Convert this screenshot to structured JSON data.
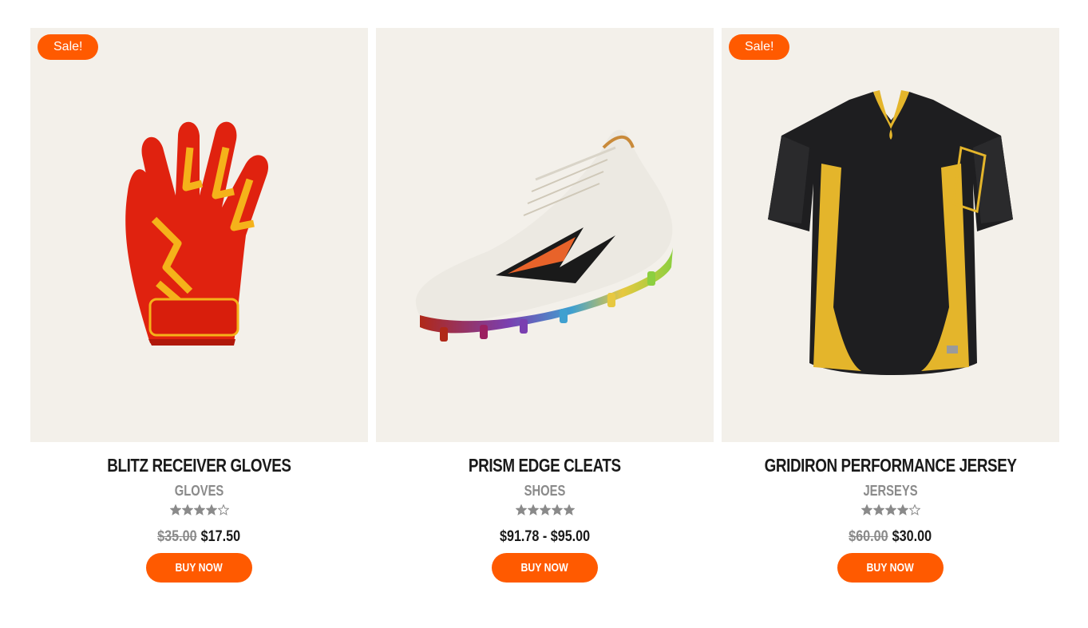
{
  "products": [
    {
      "sale_badge": "Sale!",
      "title": "Blitz Receiver Gloves",
      "category": "Gloves",
      "rating": 4,
      "price_old": "$35.00",
      "price_new": "$17.50",
      "button": "Buy Now"
    },
    {
      "sale_badge": "",
      "title": "Prism Edge Cleats",
      "category": "Shoes",
      "rating": 5,
      "price_range": "$91.78 - $95.00",
      "button": "Buy Now"
    },
    {
      "sale_badge": "Sale!",
      "title": "Gridiron Performance Jersey",
      "category": "Jerseys",
      "rating": 4,
      "price_old": "$60.00",
      "price_new": "$30.00",
      "button": "Buy Now"
    }
  ],
  "colors": {
    "accent": "#ff5a00",
    "card_bg": "#f3f0ea",
    "muted": "#8a8a8a",
    "text": "#1a1a1a"
  }
}
